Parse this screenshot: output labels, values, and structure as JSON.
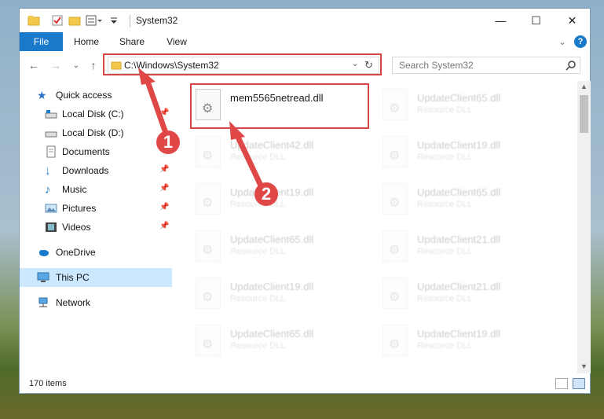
{
  "window": {
    "title": "System32"
  },
  "ribbon": {
    "tabs": [
      "File",
      "Home",
      "Share",
      "View"
    ]
  },
  "address": {
    "path": "C:\\Windows\\System32",
    "search_placeholder": "Search System32"
  },
  "nav": {
    "quick_access": "Quick access",
    "items": [
      "Local Disk (C:)",
      "Local Disk (D:)",
      "Documents",
      "Downloads",
      "Music",
      "Pictures",
      "Videos"
    ],
    "onedrive": "OneDrive",
    "this_pc": "This PC",
    "network": "Network"
  },
  "files": {
    "highlighted": {
      "name": "mem5565netread.dll"
    },
    "left": [
      {
        "name": "UpdateClient42.dll",
        "type": "Resource DLL"
      },
      {
        "name": "UpdateClient19.dll",
        "type": "Resource DLL"
      },
      {
        "name": "UpdateClient65.dll",
        "type": "Resource DLL"
      },
      {
        "name": "UpdateClient19.dll",
        "type": "Resource DLL"
      },
      {
        "name": "UpdateClient65.dll",
        "type": "Resource DLL"
      }
    ],
    "right": [
      {
        "name": "UpdateClient65.dll",
        "type": "Resource DLL"
      },
      {
        "name": "UpdateClient19.dll",
        "type": "Resource DLL"
      },
      {
        "name": "UpdateClient65.dll",
        "type": "Resource DLL"
      },
      {
        "name": "UpdateClient21.dll",
        "type": "Resource DLL"
      },
      {
        "name": "UpdateClient21.dll",
        "type": "Resource DLL"
      },
      {
        "name": "UpdateClient19.dll",
        "type": "Resource DLL"
      }
    ]
  },
  "status": {
    "count": "170 items"
  },
  "annotations": {
    "step1": "1",
    "step2": "2"
  },
  "colors": {
    "accent": "#1979ca",
    "annotation": "#e04848"
  }
}
